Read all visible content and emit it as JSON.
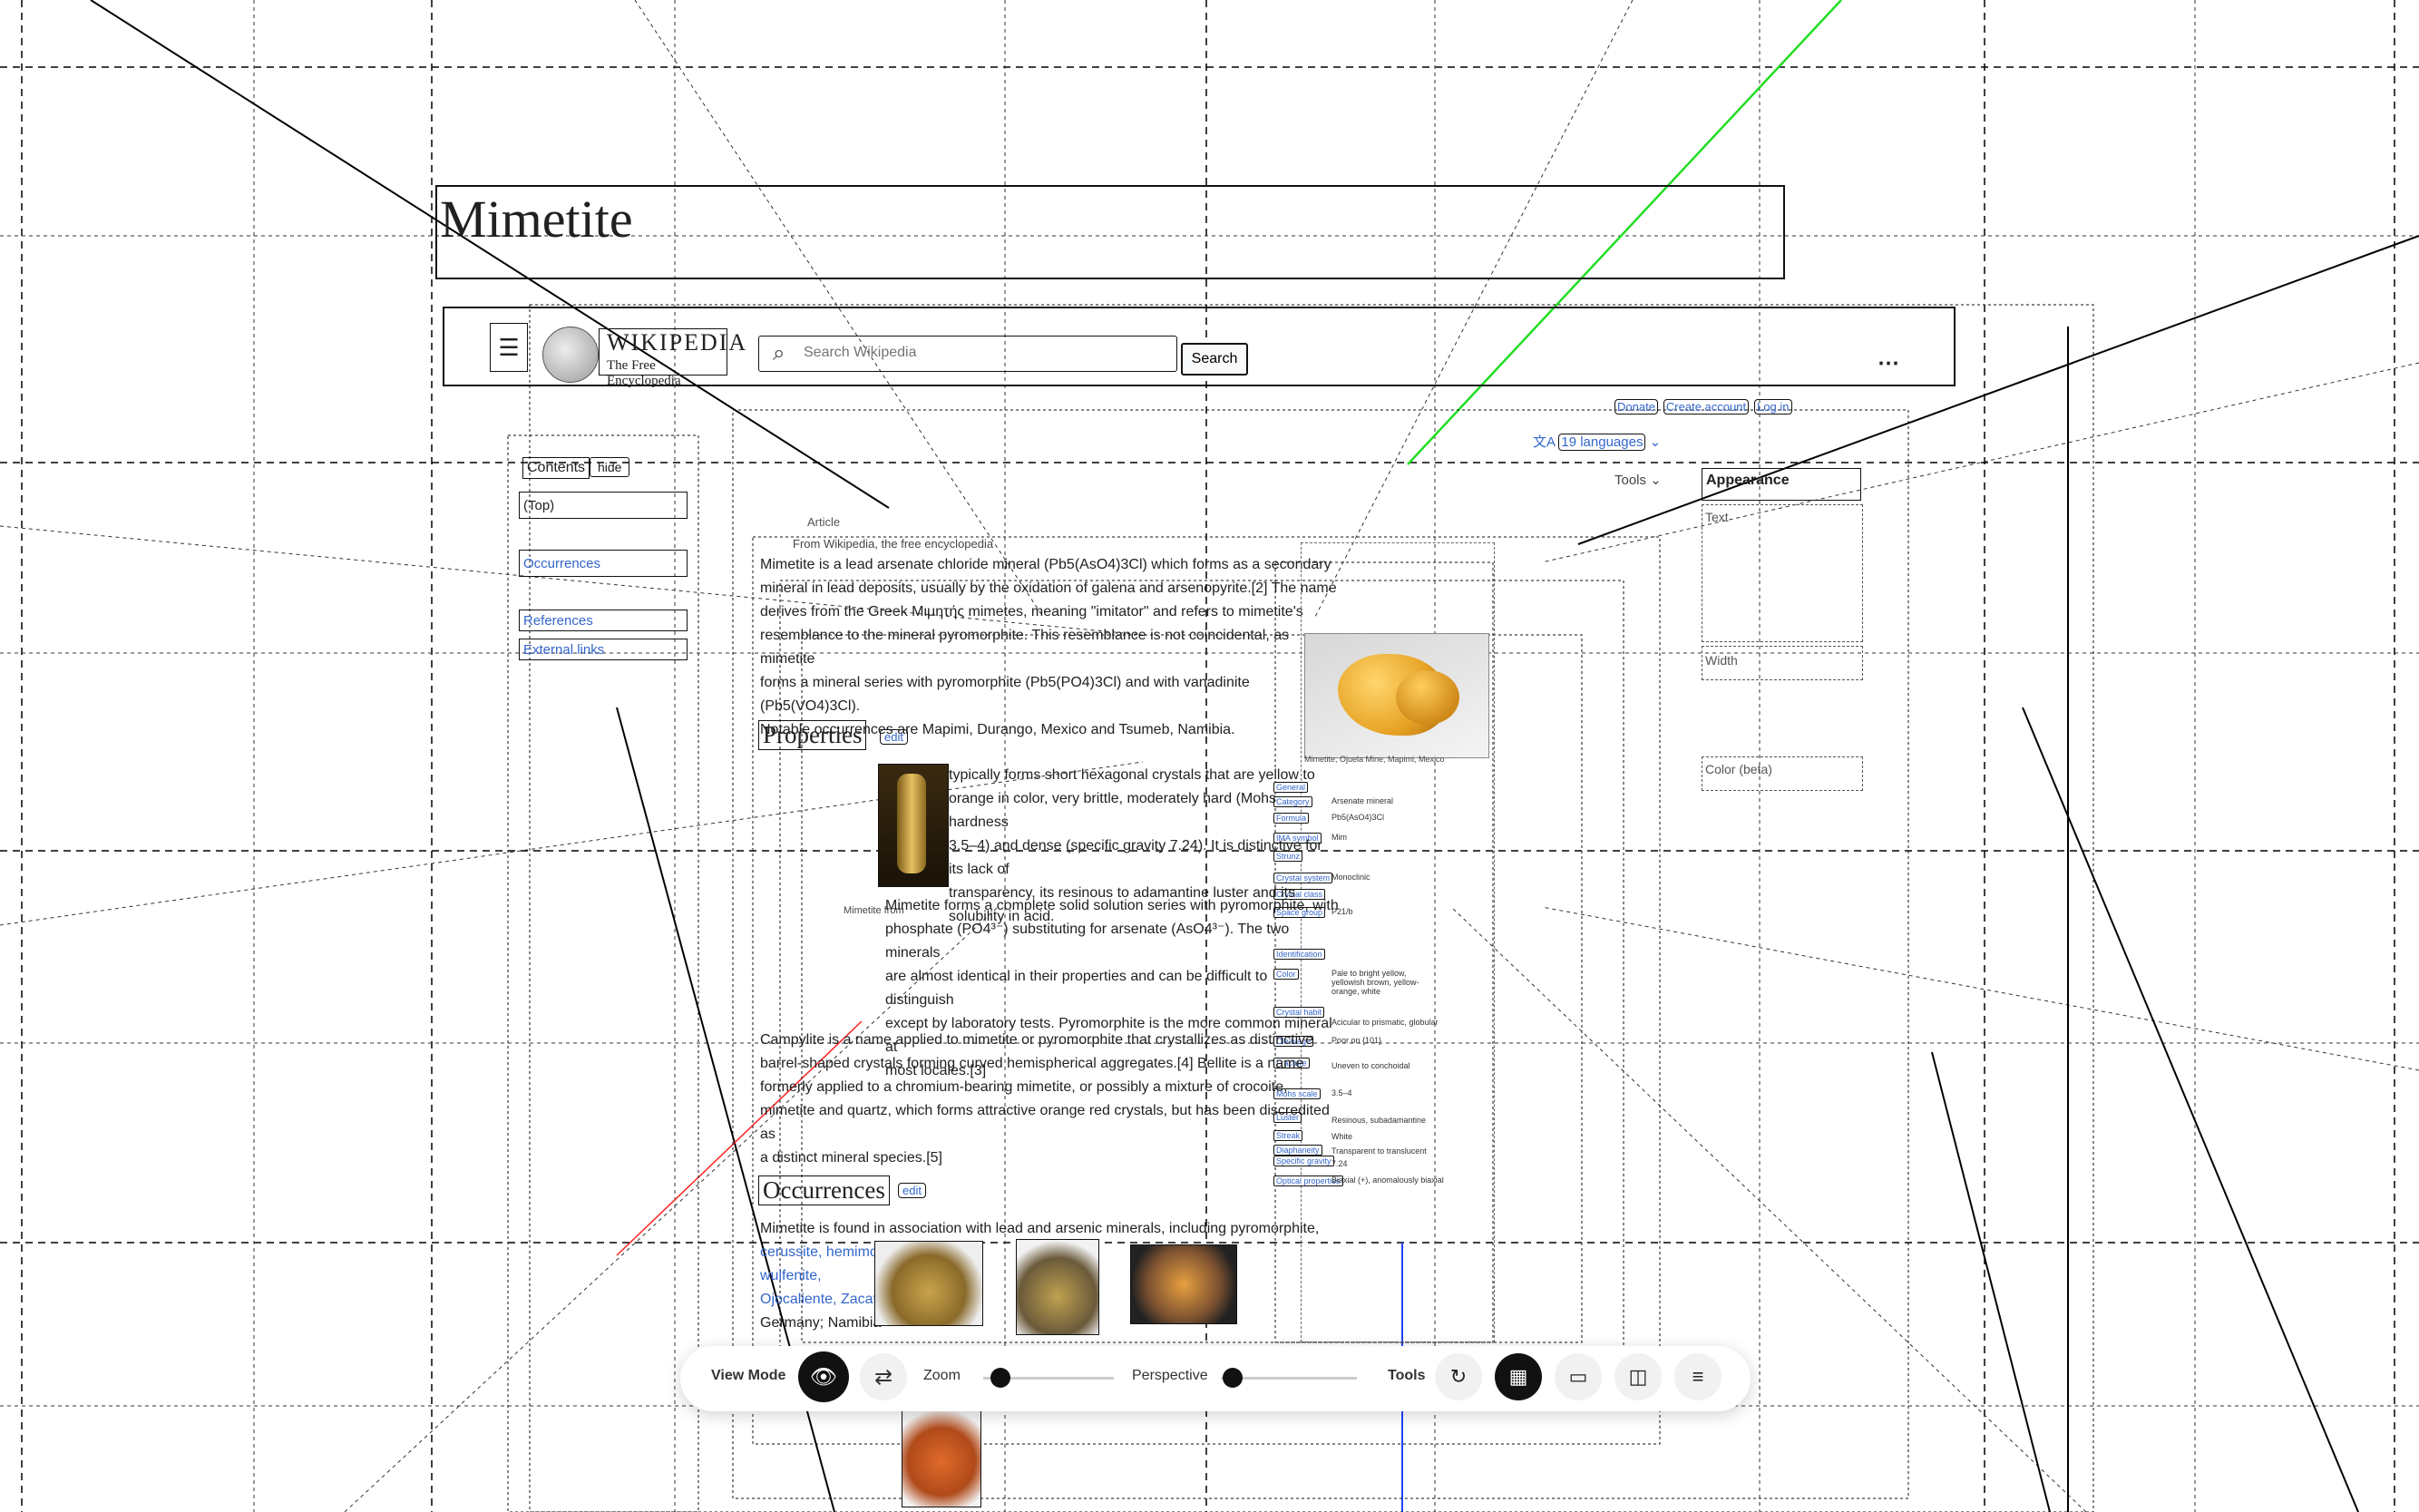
{
  "page": {
    "title": "Mimetite"
  },
  "header": {
    "wordmark_line1": "WIKIPEDIA",
    "wordmark_line2": "The Free Encyclopedia",
    "search_placeholder": "Search Wikipedia",
    "search_button": "Search",
    "user_links": [
      "Donate",
      "Create account",
      "Log in"
    ]
  },
  "toc": {
    "title": "Contents",
    "hide": "hide",
    "items": [
      "(Top)",
      "Occurrences",
      "References",
      "External links"
    ]
  },
  "right": {
    "languages": "19 languages",
    "tools": "Tools",
    "appearance": "Appearance",
    "text": "Text",
    "width": "Width",
    "color": "Color (beta)"
  },
  "article": {
    "tab": "Article",
    "from": "From Wikipedia, the free encyclopedia",
    "intro_lines": [
      "Mimetite is a lead arsenate chloride mineral (Pb5(AsO4)3Cl) which forms as a secondary",
      "mineral in lead deposits, usually by the oxidation of galena and arsenopyrite.[2] The name",
      "derives from the Greek Μιμητής mimetes, meaning \"imitator\" and refers to mimetite's",
      "resemblance to the mineral pyromorphite. This resemblance is not coincidental, as mimetite",
      "forms a mineral series with pyromorphite (Pb5(PO4)3Cl) and with vanadinite (Pb5(VO4)3Cl).",
      "Notable occurrences are Mapimi, Durango, Mexico and Tsumeb, Namibia."
    ],
    "properties_heading": "Properties",
    "edit": "edit",
    "properties_lines": [
      "typically forms short hexagonal crystals that are yellow to",
      "orange in color, very brittle, moderately hard (Mohs hardness",
      "3.5–4) and dense (specific gravity 7.24). It is distinctive for its lack of",
      "transparency, its resinous to adamantine luster and its solubility in acid."
    ],
    "solid_solution_lines": [
      "Mimetite forms a complete solid solution series with pyromorphite, with",
      "phosphate (PO4³⁻) substituting for arsenate (AsO4³⁻). The two minerals",
      "are almost identical in their properties and can be difficult to distinguish",
      "except by laboratory tests. Pyromorphite is the more common mineral at",
      "most locales.[3]"
    ],
    "campylite_lines": [
      "Campylite is a name applied to mimetite or pyromorphite that crystallizes as distinctive",
      "barrel-shaped crystals forming curved hemispherical aggregates.[4] Bellite is a name",
      "formerly applied to a chromium-bearing mimetite, or possibly a mixture of crocoite,",
      "mimetite and quartz, which forms attractive orange red crystals, but has been discredited as",
      "a distinct mineral species.[5]"
    ],
    "occurrences_heading": "Occurrences",
    "occurrences_lines": [
      "Mimetite is found in association with lead and arsenic minerals, including pyromorphite,",
      "cerussite, hemimorphite",
      "wulfenite,",
      "Ojocaliente, Zacat",
      "Germany; Namibia"
    ],
    "caption_props": "Mimetite from",
    "infobox_caption": "Mimetite, Ojuela Mine, Mapimi, Mexico",
    "infobox_labels": [
      "General",
      "Category",
      "Formula",
      "IMA symbol",
      "Strunz",
      "Crystal system",
      "Crystal class",
      "Space group",
      "Identification",
      "Color",
      "Crystal habit",
      "Cleavage",
      "Fracture",
      "Mohs scale",
      "Luster",
      "Streak",
      "Diaphaneity",
      "Specific gravity",
      "Optical properties"
    ],
    "infobox_values": [
      "Arsenate mineral",
      "Pb5(AsO4)3Cl",
      "Mim",
      "Monoclinic",
      "P21/b",
      "Pale to bright yellow, yellowish brown, yellow-orange, white",
      "Acicular to prismatic, globular",
      "Poor on {101}",
      "Uneven to conchoidal",
      "3.5–4",
      "Resinous, subadamantine",
      "White",
      "Transparent to translucent",
      "7.24",
      "Biaxial (+), anomalously biaxial"
    ]
  },
  "toolbar": {
    "view_mode": "View Mode",
    "zoom": "Zoom",
    "perspective": "Perspective",
    "tools": "Tools",
    "zoom_level": 0.1,
    "perspective_level": 0.02
  },
  "colors": {
    "link": "#3366cc",
    "guide_green": "#22dd22",
    "guide_red": "#ff2222",
    "guide_blue": "#2244ff"
  }
}
